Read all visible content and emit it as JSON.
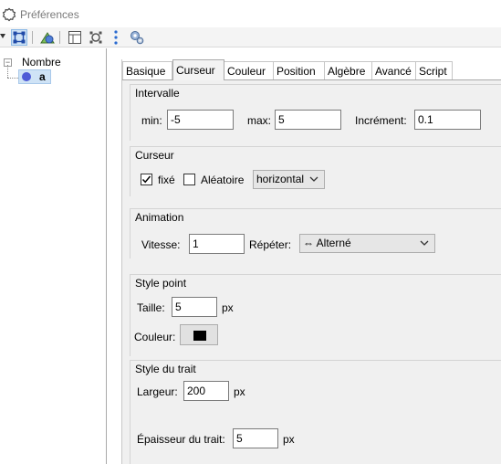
{
  "window": {
    "title": "Préférences",
    "icon": "gear-outline-icon"
  },
  "toolbar": {
    "buttons": [
      {
        "name": "object-properties-icon",
        "selected": true
      },
      {
        "name": "graphics-icon",
        "selected": false
      },
      {
        "name": "layout-icon",
        "selected": false
      },
      {
        "name": "defaults-icon",
        "selected": false
      },
      {
        "name": "more-vertical-icon",
        "selected": false
      },
      {
        "name": "advanced-settings-icon",
        "selected": false
      }
    ]
  },
  "tree": {
    "root_label": "Nombre",
    "child_label": "a",
    "child_color": "#4e5bd6"
  },
  "tabs": [
    "Basique",
    "Curseur",
    "Couleur",
    "Position",
    "Algèbre",
    "Avancé",
    "Script"
  ],
  "active_tab": "Curseur",
  "intervalle": {
    "title": "Intervalle",
    "min_label": "min:",
    "min_value": "-5",
    "max_label": "max:",
    "max_value": "5",
    "increment_label": "Incrément:",
    "increment_value": "0.1"
  },
  "curseur": {
    "title": "Curseur",
    "fixe_label": "fixé",
    "fixe_checked": true,
    "aleatoire_label": "Aléatoire",
    "aleatoire_checked": false,
    "orientation_value": "horizontal"
  },
  "animation": {
    "title": "Animation",
    "vitesse_label": "Vitesse:",
    "vitesse_value": "1",
    "repeter_label": "Répéter:",
    "repeter_value": "⇔ Alterné"
  },
  "style_point": {
    "title": "Style point",
    "taille_label": "Taille:",
    "taille_value": "5",
    "taille_unit": "px",
    "couleur_label": "Couleur:",
    "couleur_value": "#000000"
  },
  "style_trait": {
    "title": "Style du trait",
    "largeur_label": "Largeur:",
    "largeur_value": "200",
    "largeur_unit": "px",
    "epaisseur_label": "Épaisseur du trait:",
    "epaisseur_value": "5",
    "epaisseur_unit": "px"
  },
  "colors": {
    "selection": "#cfe3f6",
    "panel_bg": "#f0f0f0",
    "point_color": "#4e5bd6"
  }
}
